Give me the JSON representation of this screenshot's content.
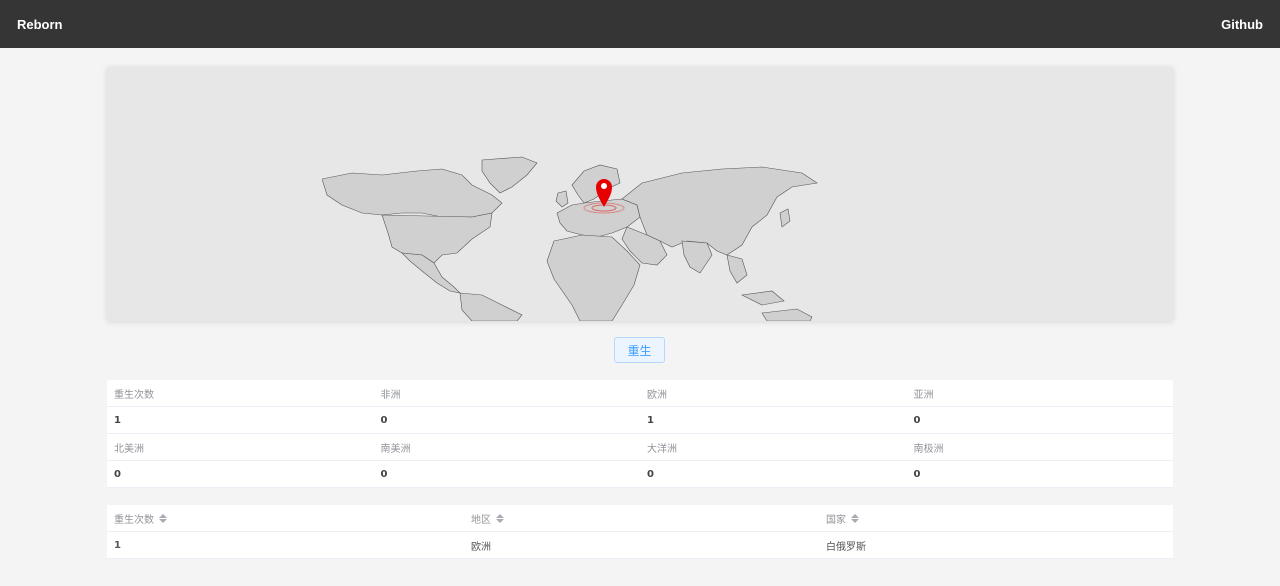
{
  "nav": {
    "brand": "Reborn",
    "github_label": "Github"
  },
  "map": {
    "marker_region": "欧洲",
    "marker_color": "#e60000",
    "land_color": "#d0d0d0",
    "ocean_color": "#e7e7e7"
  },
  "reborn_button": {
    "label": "重生"
  },
  "stats": {
    "row1_headers": [
      "重生次数",
      "非洲",
      "欧洲",
      "亚洲"
    ],
    "row1_values": [
      "1",
      "0",
      "1",
      "0"
    ],
    "row2_headers": [
      "北美洲",
      "南美洲",
      "大洋洲",
      "南极洲"
    ],
    "row2_values": [
      "0",
      "0",
      "0",
      "0"
    ]
  },
  "records": {
    "columns": [
      "重生次数",
      "地区",
      "国家"
    ],
    "rows": [
      [
        "1",
        "欧洲",
        "白俄罗斯"
      ]
    ]
  }
}
